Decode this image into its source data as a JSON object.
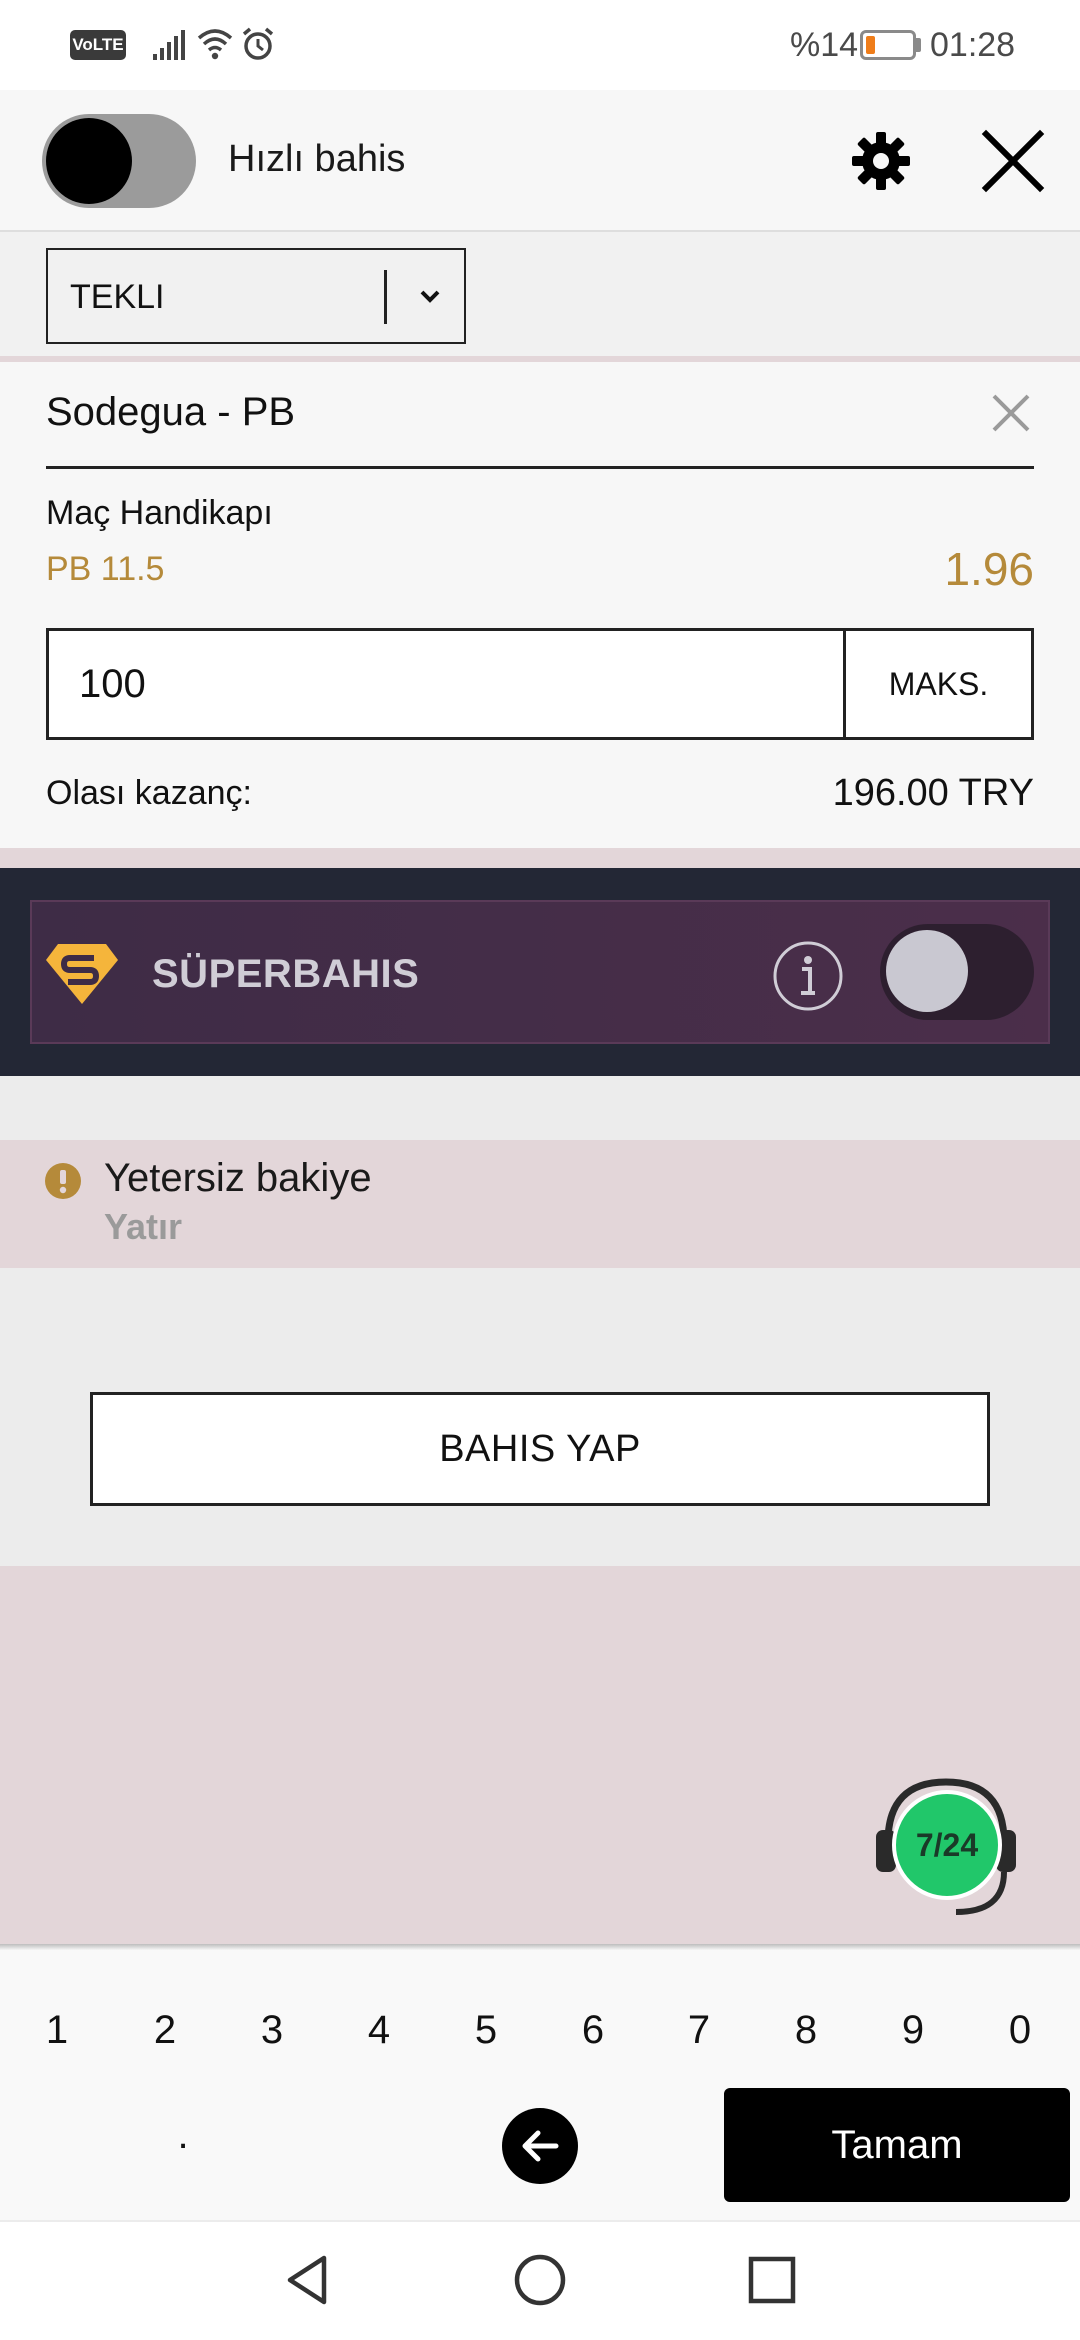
{
  "status_bar": {
    "volte": "VoLTE",
    "battery_percent": "%14",
    "battery_level": 0.14,
    "time": "01:28",
    "icons": [
      "signal-icon",
      "wifi-icon",
      "alarm-icon",
      "battery-icon"
    ]
  },
  "header": {
    "quick_bet_label": "Hızlı bahis",
    "quick_bet_on": false,
    "icons": [
      "settings-gear-icon",
      "close-icon"
    ]
  },
  "bet_type": {
    "selected": "TEKLI"
  },
  "bet": {
    "match": "Sodegua - PB",
    "market": "Maç Handikapı",
    "selection": "PB 11.5",
    "odds": "1.96",
    "stake": "100",
    "max_label": "MAKS.",
    "potential_win_label": "Olası kazanç:",
    "potential_win_value": "196.00 TRY"
  },
  "superbahis": {
    "label": "SÜPERBAHIS",
    "enabled": false
  },
  "warning": {
    "text": "Yetersiz bakiye",
    "link": "Yatır"
  },
  "place_bet_label": "BAHIS YAP",
  "chat": {
    "badge": "7/24"
  },
  "keyboard": {
    "digits": [
      "1",
      "2",
      "3",
      "4",
      "5",
      "6",
      "7",
      "8",
      "9",
      "0"
    ],
    "dot": ".",
    "done": "Tamam"
  },
  "colors": {
    "accent_gold": "#b58a3a",
    "superbahis_bg": "#4b2e4a",
    "warning_bg": "#e3d6d9",
    "chat_green": "#21c76a"
  }
}
